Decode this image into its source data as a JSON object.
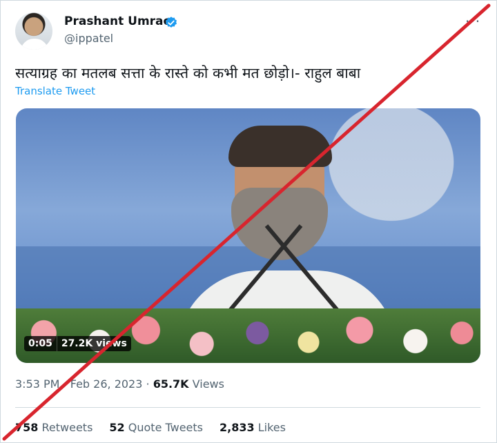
{
  "author": {
    "name": "Prashant Umrao",
    "handle": "@ippatel",
    "verified_badge": "verified-check-icon"
  },
  "more_menu": "···",
  "tweet": {
    "text": "सत्याग्रह का मतलब सत्ता के रास्ते को कभी मत छोड़ो।- राहुल बाबा",
    "translate_label": "Translate Tweet"
  },
  "media": {
    "duration": "0:05",
    "views": "27.2K views"
  },
  "meta": {
    "time": "3:53 PM",
    "separator": "·",
    "date": "Feb 26, 2023",
    "separator2": "·",
    "views_count": "65.7K",
    "views_label": "Views"
  },
  "stats": {
    "retweets_count": "758",
    "retweets_label": "Retweets",
    "quotes_count": "52",
    "quotes_label": "Quote Tweets",
    "likes_count": "2,833",
    "likes_label": "Likes"
  },
  "colors": {
    "accent": "#1d9bf0",
    "strike": "#d8252e",
    "muted": "#536471"
  }
}
